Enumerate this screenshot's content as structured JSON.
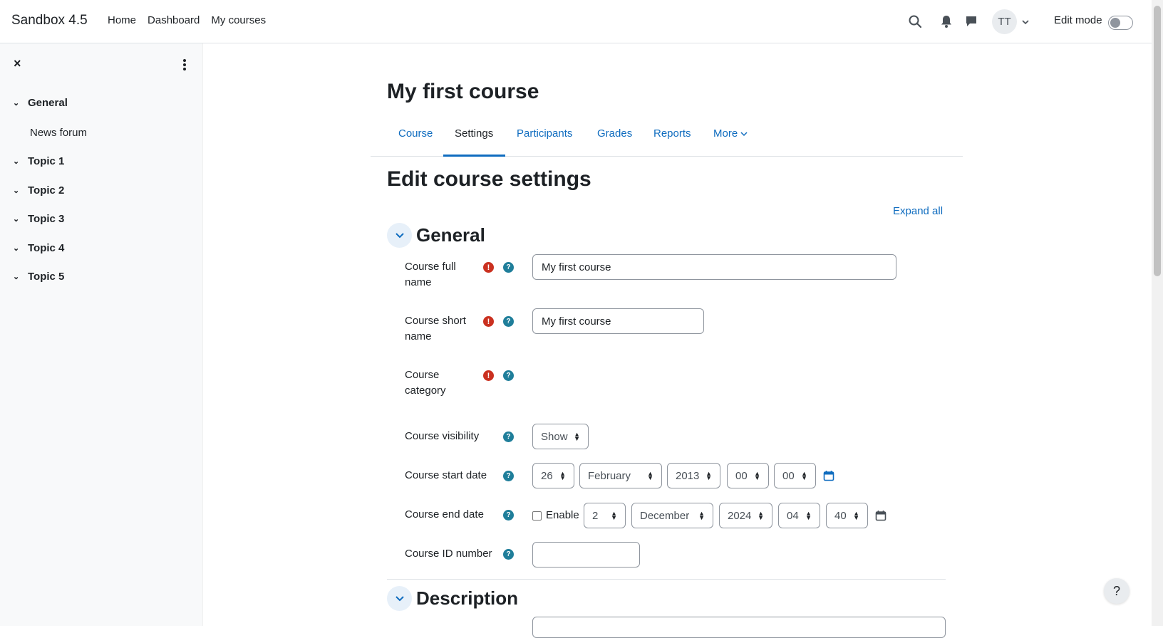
{
  "site": {
    "brand": "Sandbox 4.5"
  },
  "primary_nav": {
    "home": "Home",
    "dashboard": "Dashboard",
    "my_courses": "My courses"
  },
  "user": {
    "initials": "TT"
  },
  "edit_mode": {
    "label": "Edit mode",
    "enabled": false
  },
  "drawer": {
    "close_label": "×",
    "sections": [
      {
        "label": "General",
        "items": [
          "News forum"
        ]
      },
      {
        "label": "Topic 1"
      },
      {
        "label": "Topic 2"
      },
      {
        "label": "Topic 3"
      },
      {
        "label": "Topic 4"
      },
      {
        "label": "Topic 5"
      }
    ]
  },
  "course": {
    "title": "My first course"
  },
  "secondary_nav": {
    "tabs": [
      {
        "label": "Course"
      },
      {
        "label": "Settings",
        "active": true
      },
      {
        "label": "Participants"
      },
      {
        "label": "Grades"
      },
      {
        "label": "Reports"
      },
      {
        "label": "More"
      }
    ]
  },
  "page": {
    "heading": "Edit course settings",
    "expand_all": "Expand all"
  },
  "form": {
    "general_title": "General",
    "description_title": "Description",
    "full_name": {
      "label": "Course full name",
      "value": "My first course"
    },
    "short_name": {
      "label": "Course short name",
      "value": "My first course"
    },
    "category": {
      "label": "Course category"
    },
    "visibility": {
      "label": "Course visibility",
      "value": "Show"
    },
    "start_date": {
      "label": "Course start date",
      "day": "26",
      "month": "February",
      "year": "2013",
      "hour": "00",
      "minute": "00"
    },
    "end_date": {
      "label": "Course end date",
      "enable_label": "Enable",
      "enabled": false,
      "day": "2",
      "month": "December",
      "year": "2024",
      "hour": "04",
      "minute": "40"
    },
    "id_number": {
      "label": "Course ID number",
      "value": ""
    }
  },
  "help_button": "?",
  "colors": {
    "accent": "#0f6cbf",
    "required": "#ca3120",
    "help": "#1f7e9a"
  }
}
